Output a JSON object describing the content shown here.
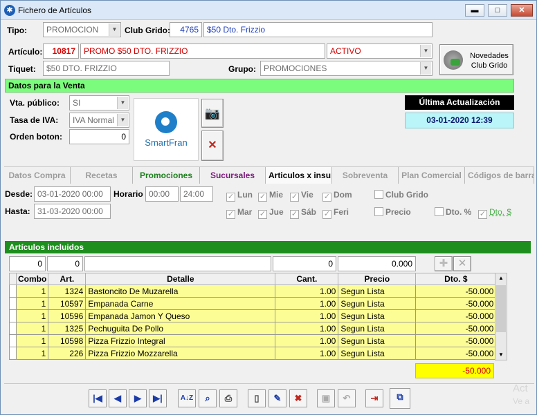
{
  "window": {
    "title": "Fichero de Artículos",
    "min": "▬",
    "max": "□",
    "close": "✕"
  },
  "row1": {
    "tipo_label": "Tipo:",
    "tipo_value": "PROMOCION",
    "club_label": "Club Grido:",
    "club_code": "4765",
    "club_desc": "$50 Dto. Frizzio"
  },
  "row2": {
    "articulo_label": "Artículo:",
    "articulo_code": "10817",
    "articulo_desc": "PROMO $50 DTO. FRIZZIO",
    "estado": "ACTIVO"
  },
  "row3": {
    "tiquet_label": "Tiquet:",
    "tiquet_value": "$50 DTO. FRIZZIO",
    "grupo_label": "Grupo:",
    "grupo_value": "PROMOCIONES"
  },
  "novedades": {
    "line1": "Novedades",
    "line2": "Club Grido"
  },
  "venta": {
    "header": "Datos para la Venta",
    "vta_label": "Vta. público:",
    "vta_value": "SI",
    "iva_label": "Tasa de IVA:",
    "iva_value": "IVA Normal",
    "orden_label": "Orden boton:",
    "orden_value": "0",
    "logo_text": "SmartFran",
    "ult_act_label": "Última Actualización",
    "ult_act_value": "03-01-2020 12:39"
  },
  "tabs": [
    "Datos Compra",
    "Recetas",
    "Promociones",
    "Sucursales",
    "Articulos x insu",
    "Sobreventa",
    "Plan Comercial",
    "Códigos de barra"
  ],
  "promo": {
    "desde_label": "Desde:",
    "desde_value": "03-01-2020 00:00",
    "hasta_label": "Hasta:",
    "hasta_value": "31-03-2020 00:00",
    "horario_label": "Horario",
    "horario_from": "00:00",
    "horario_to": "24:00",
    "days_row1": [
      "Lun",
      "Mie",
      "Vie",
      "Dom"
    ],
    "days_row2": [
      "Mar",
      "Jue",
      "Sáb",
      "Feri"
    ],
    "club_grido": "Club Grido",
    "precio": "Precio",
    "dto_pct": "Dto. %",
    "dto_money": "Dto. $",
    "check": "✓"
  },
  "incluidos": {
    "header": "Artículos incluidos",
    "entry": {
      "combo": "0",
      "art": "0",
      "detalle": "",
      "cant": "0",
      "precio": "0.000"
    },
    "columns": [
      "Combo",
      "Art.",
      "Detalle",
      "Cant.",
      "Precio",
      "Dto. $"
    ],
    "rows": [
      [
        "1",
        "1324",
        "Bastoncito De Muzarella",
        "1.00",
        "Segun Lista",
        "-50.000"
      ],
      [
        "1",
        "10597",
        "Empanada Carne",
        "1.00",
        "Segun Lista",
        "-50.000"
      ],
      [
        "1",
        "10596",
        "Empanada Jamon Y Queso",
        "1.00",
        "Segun Lista",
        "-50.000"
      ],
      [
        "1",
        "1325",
        "Pechuguita De Pollo",
        "1.00",
        "Segun Lista",
        "-50.000"
      ],
      [
        "1",
        "10598",
        "Pizza Frizzio Integral",
        "1.00",
        "Segun Lista",
        "-50.000"
      ],
      [
        "1",
        "226",
        "Pizza Frizzio Mozzarella",
        "1.00",
        "Segun Lista",
        "-50.000"
      ]
    ],
    "total": "-50.000"
  },
  "watermark": {
    "line1": "Act",
    "line2": "Ve a"
  },
  "colors": {
    "accent_green": "#7cfc7c",
    "dark_green": "#1e8f1e",
    "row_yellow": "#fdfd96",
    "total_yellow": "#ffff00",
    "update_cyan": "#b9f5f9"
  }
}
